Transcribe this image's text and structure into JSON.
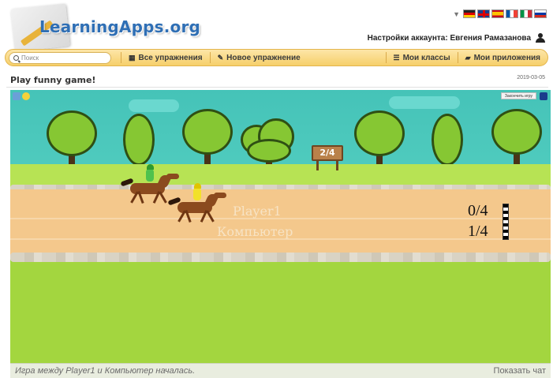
{
  "header": {
    "logo_text": "LearningApps.org",
    "account_label": "Настройки аккаунта: Евгения Рамазанова"
  },
  "navbar": {
    "search_placeholder": "Поиск",
    "items": [
      {
        "label": "Все упражнения",
        "icon": "grid-icon"
      },
      {
        "label": "Новое упражнение",
        "icon": "pencil-icon"
      },
      {
        "label": "Мои классы",
        "icon": "list-icon"
      },
      {
        "label": "Мои приложения",
        "icon": "folder-icon"
      }
    ]
  },
  "app": {
    "title": "Play funny game!",
    "date": "2019-03-05"
  },
  "game": {
    "end_button": "Закончить игру",
    "sign_text": "2/4",
    "players": [
      {
        "name": "Player1",
        "score": "0/4",
        "jockey_color": "#4ec24e"
      },
      {
        "name": "Компьютер",
        "score": "1/4",
        "jockey_color": "#f2e12a"
      }
    ]
  },
  "status": {
    "message": "Игра между Player1 и Компьютер началась.",
    "show_chat": "Показать чат"
  },
  "colors": {
    "sky": "#45c3b8",
    "grass": "#a3d63f",
    "track": "#f4c88c",
    "navbar": "#f6cf6a"
  }
}
